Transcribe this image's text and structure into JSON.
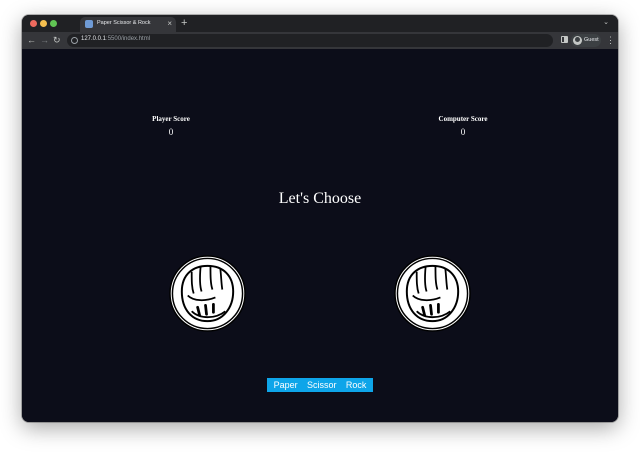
{
  "browser": {
    "tab_title": "Paper Scissor & Rock",
    "tab_close_glyph": "×",
    "new_tab_glyph": "+",
    "tab_search_glyph": "⌄",
    "url_host": "127.0.0.1",
    "url_path": ":5500/index.html",
    "profile_label": "Guest",
    "nav_back_glyph": "←",
    "nav_forward_glyph": "→",
    "nav_reload_glyph": "↻",
    "menu_glyph": "⋮"
  },
  "game": {
    "player_label": "Player Score",
    "player_score": "0",
    "computer_label": "Computer Score",
    "computer_score": "0",
    "heading": "Let's Choose",
    "player_hand_icon": "fist-icon",
    "computer_hand_icon": "fist-icon",
    "buttons": {
      "paper": "Paper",
      "scissor": "Scissor",
      "rock": "Rock"
    }
  },
  "colors": {
    "page_background": "#0c0d19",
    "button_background": "#0ea5e9",
    "text": "#ffffff"
  }
}
